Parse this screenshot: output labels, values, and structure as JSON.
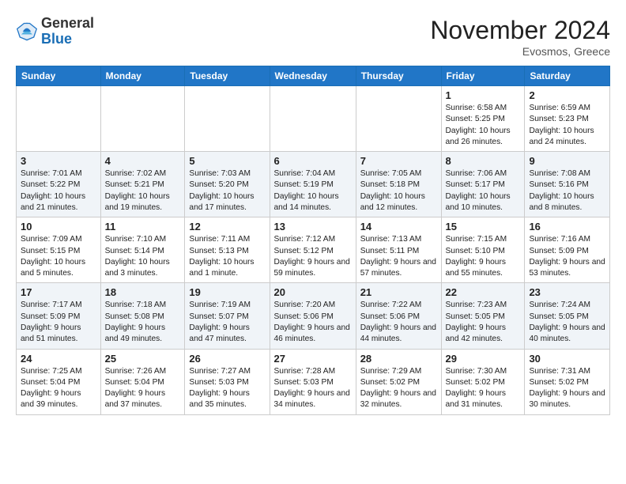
{
  "header": {
    "logo_general": "General",
    "logo_blue": "Blue",
    "month_year": "November 2024",
    "location": "Evosmos, Greece"
  },
  "weekdays": [
    "Sunday",
    "Monday",
    "Tuesday",
    "Wednesday",
    "Thursday",
    "Friday",
    "Saturday"
  ],
  "weeks": [
    [
      {
        "day": "",
        "info": ""
      },
      {
        "day": "",
        "info": ""
      },
      {
        "day": "",
        "info": ""
      },
      {
        "day": "",
        "info": ""
      },
      {
        "day": "",
        "info": ""
      },
      {
        "day": "1",
        "info": "Sunrise: 6:58 AM\nSunset: 5:25 PM\nDaylight: 10 hours and 26 minutes."
      },
      {
        "day": "2",
        "info": "Sunrise: 6:59 AM\nSunset: 5:23 PM\nDaylight: 10 hours and 24 minutes."
      }
    ],
    [
      {
        "day": "3",
        "info": "Sunrise: 7:01 AM\nSunset: 5:22 PM\nDaylight: 10 hours and 21 minutes."
      },
      {
        "day": "4",
        "info": "Sunrise: 7:02 AM\nSunset: 5:21 PM\nDaylight: 10 hours and 19 minutes."
      },
      {
        "day": "5",
        "info": "Sunrise: 7:03 AM\nSunset: 5:20 PM\nDaylight: 10 hours and 17 minutes."
      },
      {
        "day": "6",
        "info": "Sunrise: 7:04 AM\nSunset: 5:19 PM\nDaylight: 10 hours and 14 minutes."
      },
      {
        "day": "7",
        "info": "Sunrise: 7:05 AM\nSunset: 5:18 PM\nDaylight: 10 hours and 12 minutes."
      },
      {
        "day": "8",
        "info": "Sunrise: 7:06 AM\nSunset: 5:17 PM\nDaylight: 10 hours and 10 minutes."
      },
      {
        "day": "9",
        "info": "Sunrise: 7:08 AM\nSunset: 5:16 PM\nDaylight: 10 hours and 8 minutes."
      }
    ],
    [
      {
        "day": "10",
        "info": "Sunrise: 7:09 AM\nSunset: 5:15 PM\nDaylight: 10 hours and 5 minutes."
      },
      {
        "day": "11",
        "info": "Sunrise: 7:10 AM\nSunset: 5:14 PM\nDaylight: 10 hours and 3 minutes."
      },
      {
        "day": "12",
        "info": "Sunrise: 7:11 AM\nSunset: 5:13 PM\nDaylight: 10 hours and 1 minute."
      },
      {
        "day": "13",
        "info": "Sunrise: 7:12 AM\nSunset: 5:12 PM\nDaylight: 9 hours and 59 minutes."
      },
      {
        "day": "14",
        "info": "Sunrise: 7:13 AM\nSunset: 5:11 PM\nDaylight: 9 hours and 57 minutes."
      },
      {
        "day": "15",
        "info": "Sunrise: 7:15 AM\nSunset: 5:10 PM\nDaylight: 9 hours and 55 minutes."
      },
      {
        "day": "16",
        "info": "Sunrise: 7:16 AM\nSunset: 5:09 PM\nDaylight: 9 hours and 53 minutes."
      }
    ],
    [
      {
        "day": "17",
        "info": "Sunrise: 7:17 AM\nSunset: 5:09 PM\nDaylight: 9 hours and 51 minutes."
      },
      {
        "day": "18",
        "info": "Sunrise: 7:18 AM\nSunset: 5:08 PM\nDaylight: 9 hours and 49 minutes."
      },
      {
        "day": "19",
        "info": "Sunrise: 7:19 AM\nSunset: 5:07 PM\nDaylight: 9 hours and 47 minutes."
      },
      {
        "day": "20",
        "info": "Sunrise: 7:20 AM\nSunset: 5:06 PM\nDaylight: 9 hours and 46 minutes."
      },
      {
        "day": "21",
        "info": "Sunrise: 7:22 AM\nSunset: 5:06 PM\nDaylight: 9 hours and 44 minutes."
      },
      {
        "day": "22",
        "info": "Sunrise: 7:23 AM\nSunset: 5:05 PM\nDaylight: 9 hours and 42 minutes."
      },
      {
        "day": "23",
        "info": "Sunrise: 7:24 AM\nSunset: 5:05 PM\nDaylight: 9 hours and 40 minutes."
      }
    ],
    [
      {
        "day": "24",
        "info": "Sunrise: 7:25 AM\nSunset: 5:04 PM\nDaylight: 9 hours and 39 minutes."
      },
      {
        "day": "25",
        "info": "Sunrise: 7:26 AM\nSunset: 5:04 PM\nDaylight: 9 hours and 37 minutes."
      },
      {
        "day": "26",
        "info": "Sunrise: 7:27 AM\nSunset: 5:03 PM\nDaylight: 9 hours and 35 minutes."
      },
      {
        "day": "27",
        "info": "Sunrise: 7:28 AM\nSunset: 5:03 PM\nDaylight: 9 hours and 34 minutes."
      },
      {
        "day": "28",
        "info": "Sunrise: 7:29 AM\nSunset: 5:02 PM\nDaylight: 9 hours and 32 minutes."
      },
      {
        "day": "29",
        "info": "Sunrise: 7:30 AM\nSunset: 5:02 PM\nDaylight: 9 hours and 31 minutes."
      },
      {
        "day": "30",
        "info": "Sunrise: 7:31 AM\nSunset: 5:02 PM\nDaylight: 9 hours and 30 minutes."
      }
    ]
  ]
}
